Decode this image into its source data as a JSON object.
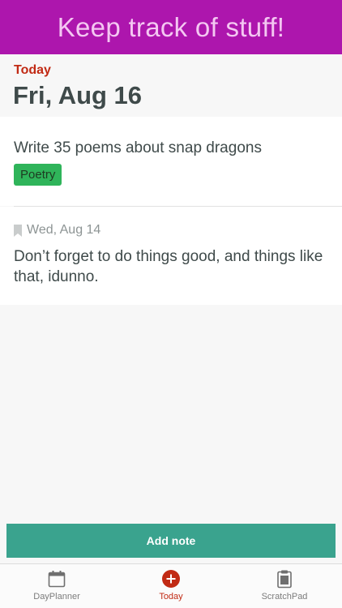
{
  "banner": {
    "text": "Keep track of stuff!"
  },
  "header": {
    "today_label": "Today",
    "date": "Fri, Aug 16"
  },
  "notes": [
    {
      "text": "Write 35 poems about snap dragons",
      "tag": "Poetry"
    },
    {
      "date": "Wed, Aug 14",
      "text": "Don’t forget to do things good, and things like that, idunno."
    }
  ],
  "actions": {
    "add_note_label": "Add note"
  },
  "tabs": [
    {
      "label": "DayPlanner",
      "icon": "calendar-icon"
    },
    {
      "label": "Today",
      "icon": "plus-circle-icon",
      "active": true
    },
    {
      "label": "ScratchPad",
      "icon": "clipboard-icon"
    }
  ],
  "colors": {
    "banner_bg": "#ad16ad",
    "banner_text": "#f4c7f2",
    "accent_red": "#c12a14",
    "tag_green": "#2fb45a",
    "button_teal": "#3aa38e"
  }
}
